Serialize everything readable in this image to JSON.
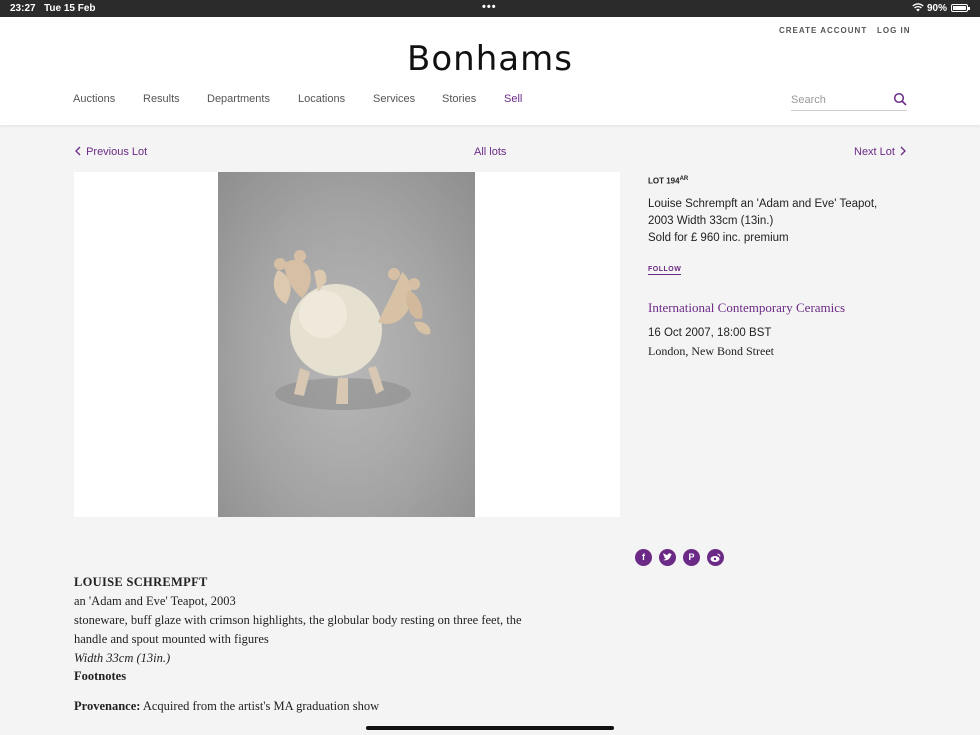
{
  "status_bar": {
    "time": "23:27",
    "date": "Tue 15 Feb",
    "dots": "•••",
    "battery": "90%"
  },
  "header": {
    "create_account": "CREATE ACCOUNT",
    "log_in": "LOG IN",
    "logo": "Bonhams",
    "nav": [
      "Auctions",
      "Results",
      "Departments",
      "Locations",
      "Services",
      "Stories",
      "Sell"
    ],
    "search_placeholder": "Search"
  },
  "lot_nav": {
    "previous": "Previous Lot",
    "all": "All lots",
    "next": "Next Lot"
  },
  "lot": {
    "number": "LOT 194",
    "number_sup": "AR",
    "title_line1": "Louise Schrempft an 'Adam and Eve' Teapot,",
    "title_line2": "2003 Width 33cm (13in.)",
    "sold": "Sold for £ 960 inc. premium",
    "follow": "FOLLOW"
  },
  "sale": {
    "name": "International Contemporary Ceramics",
    "date": "16 Oct 2007, 18:00 BST",
    "location": "London, New Bond Street"
  },
  "social": [
    "facebook-icon",
    "twitter-icon",
    "pinterest-icon",
    "weibo-icon"
  ],
  "description": {
    "artist": "LOUISE SCHREMPFT",
    "title": "an 'Adam and Eve' Teapot, 2003",
    "line1": "stoneware, buff glaze with crimson highlights, the globular body resting on three feet, the",
    "line2": "handle and spout mounted with figures",
    "dims": "Width 33cm (13in.)",
    "footnotes": "Footnotes",
    "provenance_label": "Provenance:",
    "provenance_text": " Acquired from the artist's MA graduation show"
  },
  "colors": {
    "accent": "#6b2a86",
    "page_bg": "#f4f4f4",
    "status_bar": "#2b2b2b"
  }
}
